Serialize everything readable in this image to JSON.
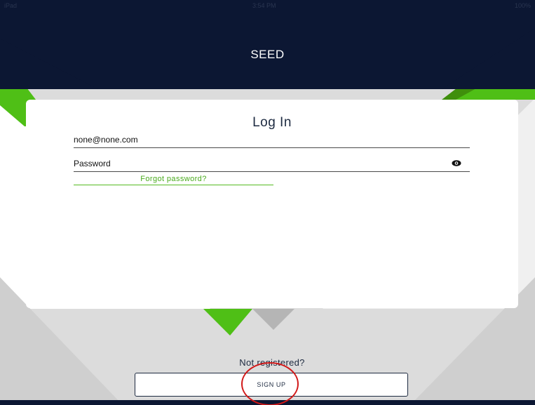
{
  "colors": {
    "header_navy": "#0c1733",
    "accent_green": "#4fbf16",
    "dark_green": "#3f8f0c",
    "background_gray": "#dcdcdc",
    "card_white": "#ffffff",
    "annotation_red": "#d11818"
  },
  "status_bar": {
    "carrier": "iPad",
    "time": "3:54 PM",
    "battery": "100%"
  },
  "header": {
    "app_title": "SEED"
  },
  "login": {
    "title": "Log In",
    "email_value": "none@none.com",
    "password_placeholder": "Password",
    "show_password_icon": "eye-icon",
    "forgot_password_label": "Forgot password?"
  },
  "footer": {
    "not_registered_text": "Not registered?",
    "signup_label": "SIGN UP"
  }
}
